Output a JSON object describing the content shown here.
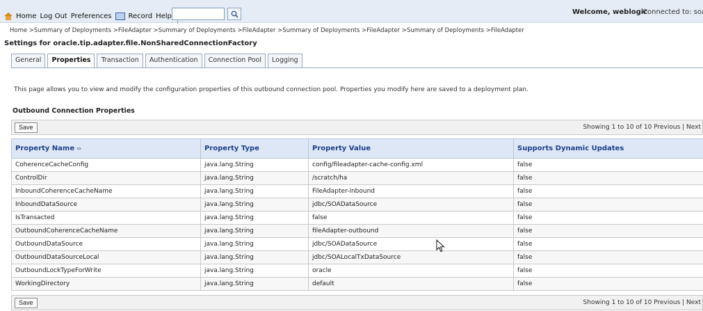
{
  "header": {
    "home_label": "Home",
    "logout_label": "Log Out",
    "preferences_label": "Preferences",
    "record_label": "Record",
    "help_label": "Help",
    "search_value": "",
    "welcome_text": "Welcome, weblogic",
    "connected_text": "Connected to: soa"
  },
  "breadcrumb": "Home >Summary of Deployments >FileAdapter >Summary of Deployments >FileAdapter >Summary of Deployments >FileAdapter >Summary of Deployments >FileAdapter",
  "settings_title": "Settings for oracle.tip.adapter.file.NonSharedConnectionFactory",
  "tabs": [
    {
      "label": "General"
    },
    {
      "label": "Properties"
    },
    {
      "label": "Transaction"
    },
    {
      "label": "Authentication"
    },
    {
      "label": "Connection Pool"
    },
    {
      "label": "Logging"
    }
  ],
  "intro_text": "This page allows you to view and modify the configuration properties of this outbound connection pool. Properties you modify here are saved to a deployment plan.",
  "section_title": "Outbound Connection Properties",
  "toolbar": {
    "save_label": "Save",
    "paging_text": "Showing 1 to 10 of 10   Previous | Next"
  },
  "table": {
    "columns": [
      "Property Name",
      "Property Type",
      "Property Value",
      "Supports Dynamic Updates"
    ],
    "rows": [
      [
        "CoherenceCacheConfig",
        "java.lang.String",
        "config/fileadapter-cache-config.xml",
        "false"
      ],
      [
        "ControlDir",
        "java.lang.String",
        "/scratch/ha",
        "false"
      ],
      [
        "InboundCoherenceCacheName",
        "java.lang.String",
        "FileAdapter-inbound",
        "false"
      ],
      [
        "InboundDataSource",
        "java.lang.String",
        "jdbc/SOADataSource",
        "false"
      ],
      [
        "IsTransacted",
        "java.lang.String",
        "false",
        "false"
      ],
      [
        "OutboundCoherenceCacheName",
        "java.lang.String",
        "fileAdapter-outbound",
        "false"
      ],
      [
        "OutboundDataSource",
        "java.lang.String",
        "jdbc/SOADataSource",
        "false"
      ],
      [
        "OutboundDataSourceLocal",
        "java.lang.String",
        "jdbc/SOALocalTxDataSource",
        "false"
      ],
      [
        "OutboundLockTypeForWrite",
        "java.lang.String",
        "oracle",
        "false"
      ],
      [
        "WorkingDirectory",
        "java.lang.String",
        "default",
        "false"
      ]
    ]
  },
  "colors": {
    "header_bg": "#e5ecf6",
    "column_header_text": "#1d3f8a"
  }
}
